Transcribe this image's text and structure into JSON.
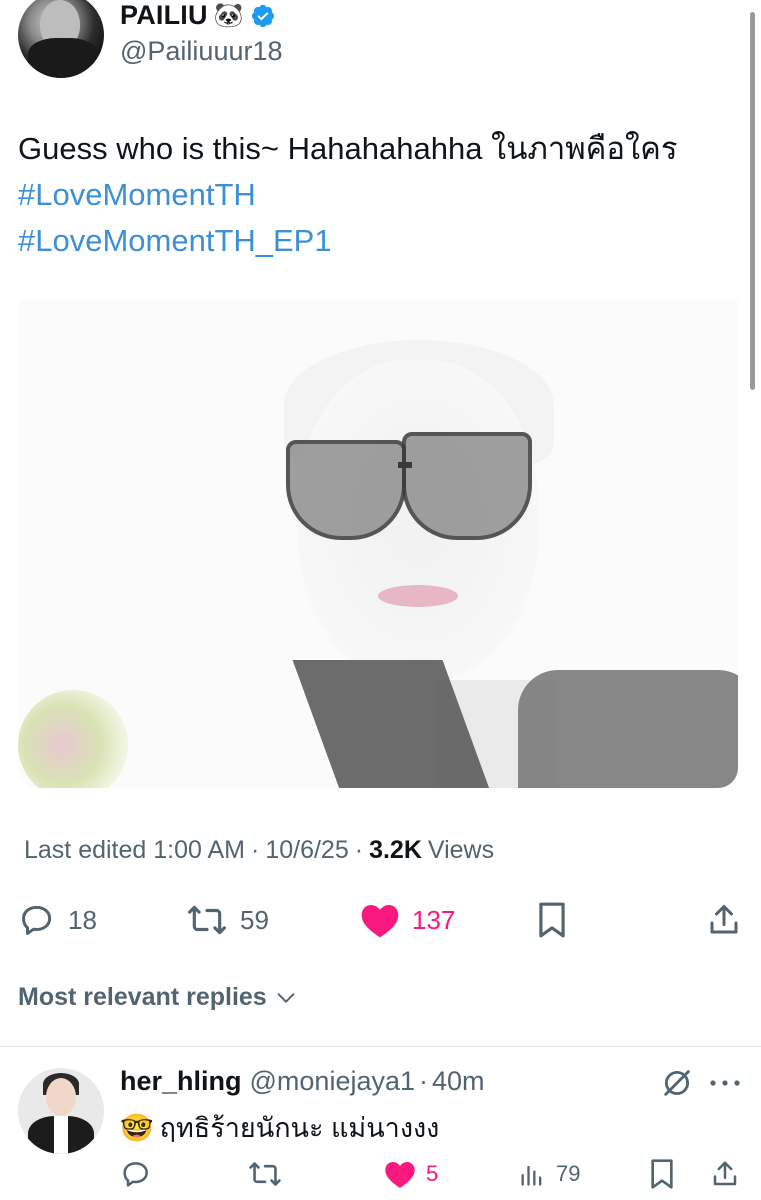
{
  "tweet": {
    "author": {
      "name": "PAILIU",
      "name_emoji": "🐼",
      "handle": "@Pailiuuur18",
      "verified": true
    },
    "text": "Guess who is this~ Hahahahahha ในภาพคือใคร",
    "hashtags": [
      "#LoveMomentTH",
      "#LoveMomentTH_EP1"
    ],
    "meta": {
      "edited": "Last edited 1:00 AM",
      "date": "10/6/25",
      "views_count": "3.2K",
      "views_label": "Views",
      "separator": "·"
    },
    "actions": {
      "replies": "18",
      "reposts": "59",
      "likes": "137"
    }
  },
  "replies_sort": {
    "label": "Most relevant replies"
  },
  "reply": {
    "name": "her_hling",
    "handle": "@moniejaya1",
    "separator": "·",
    "time": "40m",
    "emoji": "🤓",
    "text": "ฤทธิร้ายนักนะ แม่นางงง",
    "actions": {
      "likes": "5",
      "views": "79"
    }
  },
  "colors": {
    "accent": "#1d9bf0",
    "hashtag": "#3d8fd6",
    "like": "#f9197f",
    "secondary_text": "#536471"
  }
}
